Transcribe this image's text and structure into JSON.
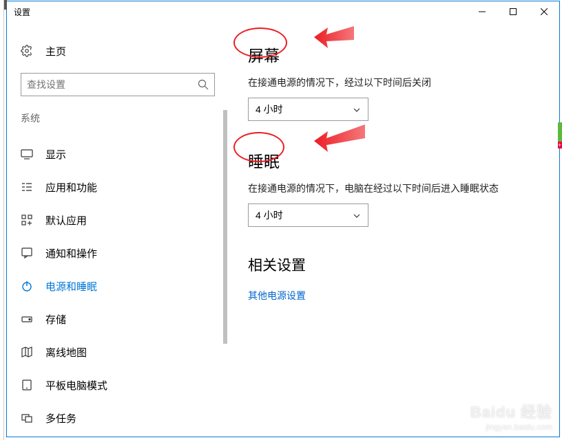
{
  "window": {
    "title": "设置"
  },
  "sidebar": {
    "home": "主页",
    "search_placeholder": "查找设置",
    "section": "系统",
    "items": [
      {
        "label": "显示"
      },
      {
        "label": "应用和功能"
      },
      {
        "label": "默认应用"
      },
      {
        "label": "通知和操作"
      },
      {
        "label": "电源和睡眠"
      },
      {
        "label": "存储"
      },
      {
        "label": "离线地图"
      },
      {
        "label": "平板电脑模式"
      },
      {
        "label": "多任务"
      }
    ]
  },
  "main": {
    "screen": {
      "title": "屏幕",
      "desc": "在接通电源的情况下，经过以下时间后关闭",
      "value": "4 小时"
    },
    "sleep": {
      "title": "睡眠",
      "desc": "在接通电源的情况下，电脑在经过以下时间后进入睡眠状态",
      "value": "4 小时"
    },
    "related": {
      "title": "相关设置",
      "link": "其他电源设置"
    }
  },
  "watermark": {
    "brand": "Baidu 经验",
    "url": "jingyan.baidu.com"
  }
}
